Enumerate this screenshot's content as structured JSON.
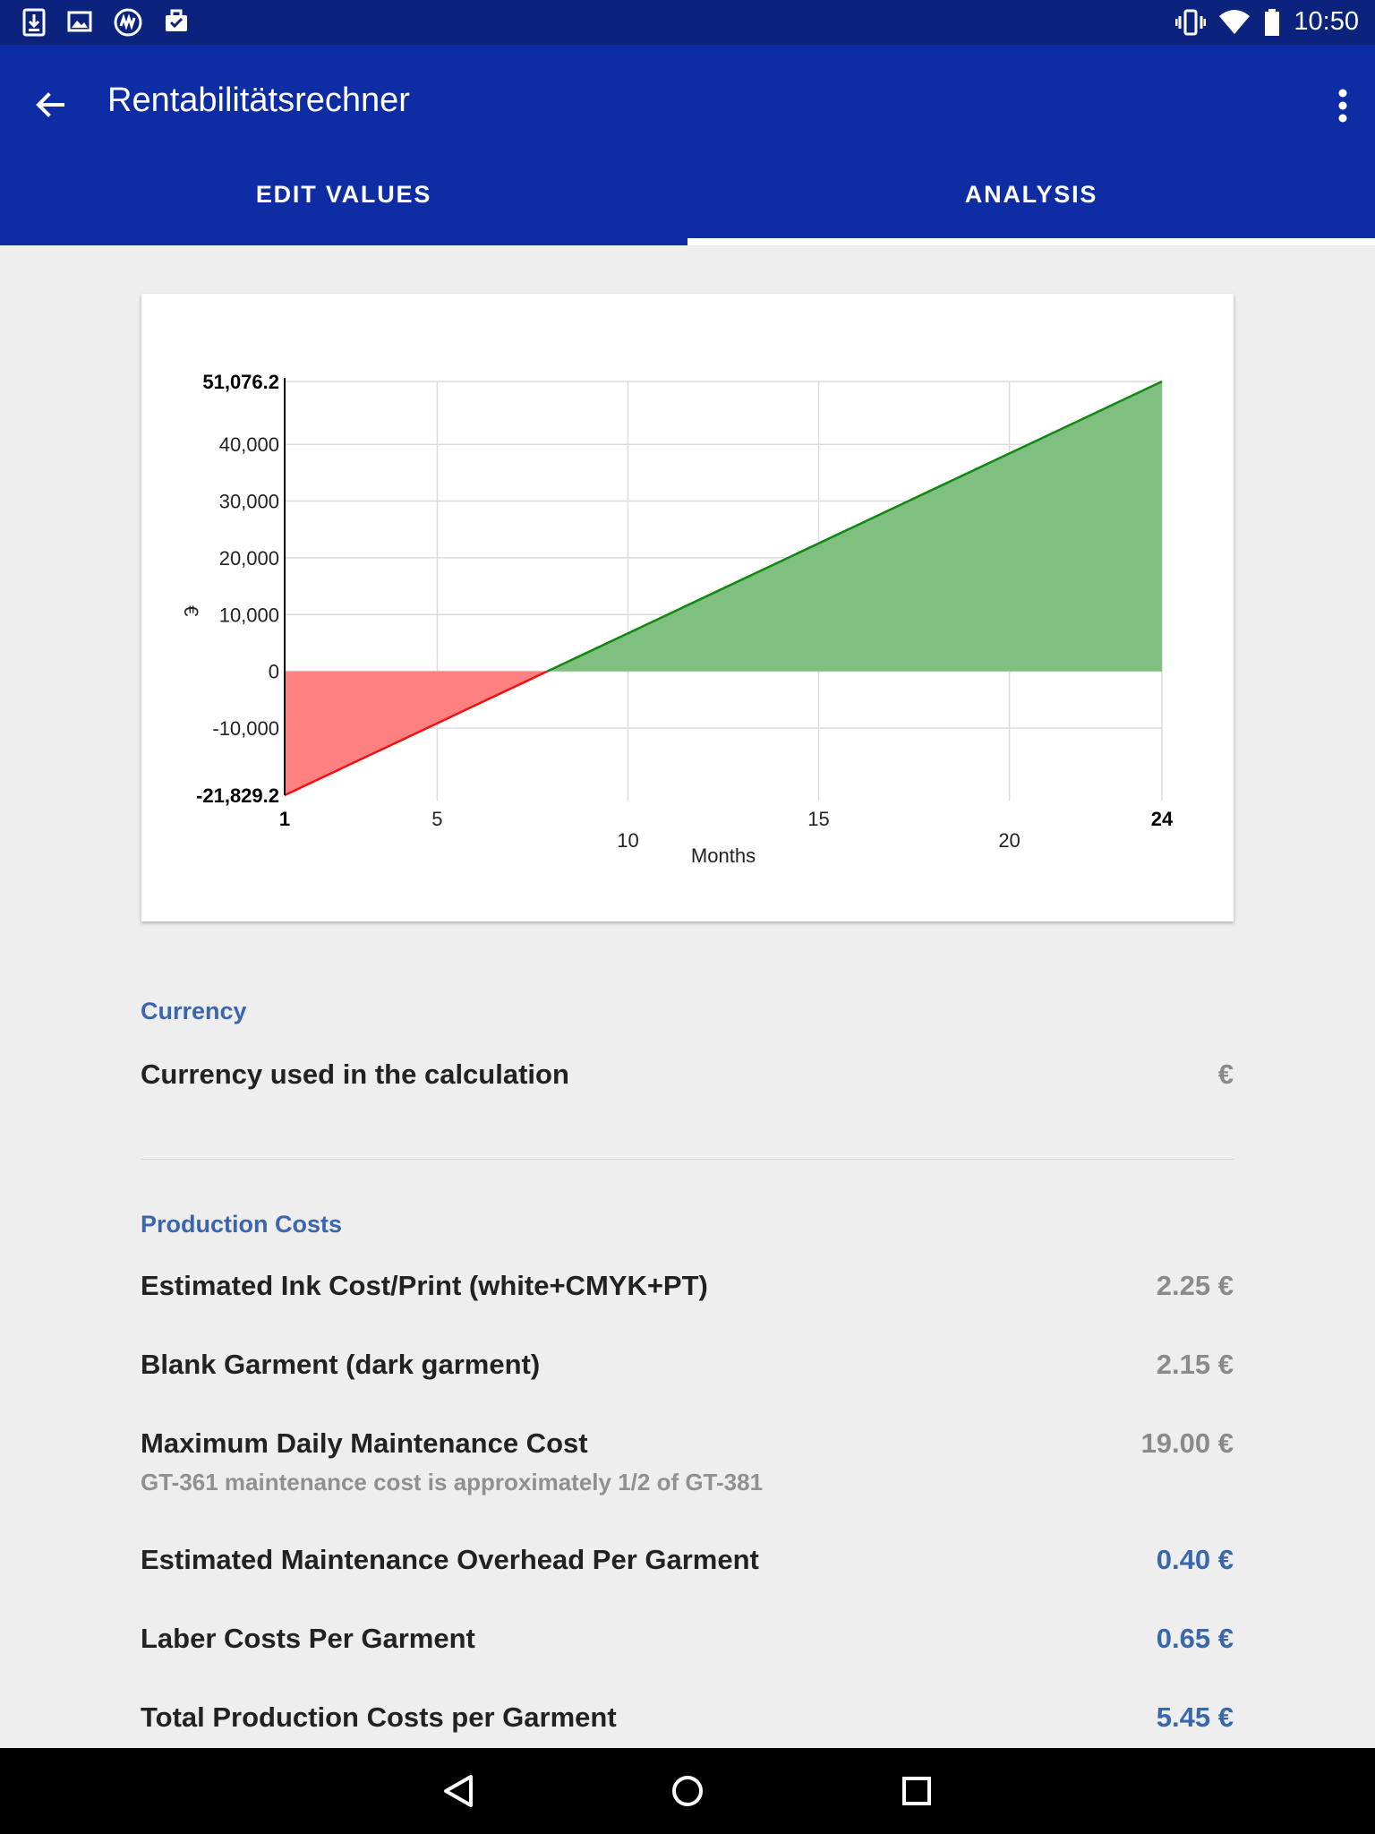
{
  "status_bar": {
    "time": "10:50",
    "left_icons": [
      "download-icon",
      "image-icon",
      "app-logo-icon",
      "briefcase-icon"
    ],
    "right_icons": [
      "vibrate-icon",
      "wifi-icon",
      "battery-icon"
    ]
  },
  "app_bar": {
    "title": "Rentabilitätsrechner",
    "back_icon": "arrow-back-icon",
    "menu_icon": "more-vert-icon",
    "colors": {
      "status": "#0b237d",
      "bar": "#0e2ca3"
    }
  },
  "tabs": [
    {
      "label": "EDIT VALUES",
      "selected": false
    },
    {
      "label": "ANALYSIS",
      "selected": true
    }
  ],
  "chart_data": {
    "type": "area",
    "xlabel": "Months",
    "ylabel": "€",
    "xlim": [
      1,
      24
    ],
    "ylim": [
      -21829.2,
      51076.2
    ],
    "x_ticks": [
      1,
      5,
      10,
      15,
      20,
      24
    ],
    "x_tick_labels": [
      "1",
      "5",
      "10",
      "15",
      "20",
      "24"
    ],
    "y_ticks": [
      -21829.2,
      -10000,
      0,
      10000,
      20000,
      30000,
      40000,
      51076.2
    ],
    "y_tick_labels": [
      "-21,829.2",
      "-10,000",
      "0",
      "10,000",
      "20,000",
      "30,000",
      "40,000",
      "51,076.2"
    ],
    "series": [
      {
        "x": [
          1,
          24
        ],
        "y": [
          -21829.2,
          51076.2
        ]
      }
    ],
    "fill_colors": {
      "negative": "#ff8080",
      "positive": "#7fbf7f"
    },
    "line_colors": {
      "negative": "#ee1111",
      "positive": "#118811"
    },
    "grid": true
  },
  "currency_section": {
    "title": "Currency",
    "label": "Currency used in the calculation",
    "value": "€"
  },
  "production_section": {
    "title": "Production Costs",
    "rows": [
      {
        "label": "Estimated Ink Cost/Print (white+CMYK+PT)",
        "value": "2.25 €",
        "highlight": false
      },
      {
        "label": "Blank Garment (dark garment)",
        "value": "2.15 €",
        "highlight": false
      },
      {
        "label": "Maximum Daily Maintenance Cost",
        "value": "19.00 €",
        "sub": "GT-361 maintenance cost is approximately 1/2 of GT-381",
        "highlight": false
      },
      {
        "label": "Estimated Maintenance Overhead Per Garment",
        "value": "0.40 €",
        "highlight": true
      },
      {
        "label": "Laber Costs Per Garment",
        "value": "0.65 €",
        "highlight": true
      },
      {
        "label": "Total Production Costs per Garment",
        "value": "5.45 €",
        "highlight": true
      }
    ]
  },
  "nav_bar": {
    "icons": [
      "nav-back-icon",
      "nav-home-icon",
      "nav-recents-icon"
    ]
  }
}
